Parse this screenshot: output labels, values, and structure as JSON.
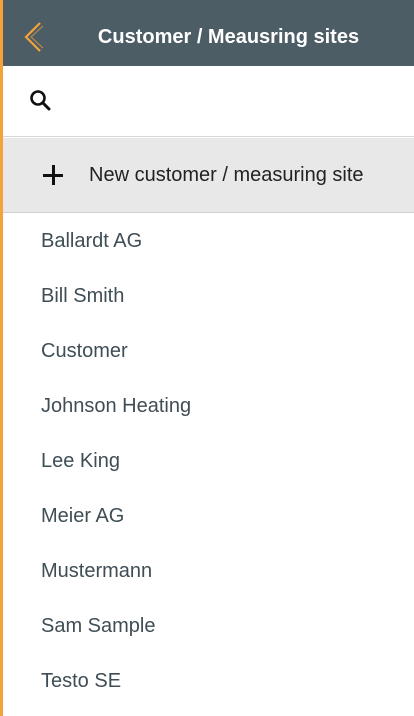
{
  "header": {
    "title": "Customer / Meausring sites",
    "back_icon": "chevron-left-icon",
    "accent_color": "#f2a33a",
    "bar_color": "#4c5d66"
  },
  "search": {
    "icon": "search-icon",
    "value": "",
    "placeholder": ""
  },
  "new_entry": {
    "icon": "plus-icon",
    "label": "New customer / measuring site"
  },
  "customers": [
    {
      "label": "Ballardt AG"
    },
    {
      "label": "Bill Smith"
    },
    {
      "label": "Customer"
    },
    {
      "label": "Johnson Heating"
    },
    {
      "label": "Lee King"
    },
    {
      "label": "Meier AG"
    },
    {
      "label": "Mustermann"
    },
    {
      "label": "Sam Sample"
    },
    {
      "label": "Testo SE"
    }
  ]
}
